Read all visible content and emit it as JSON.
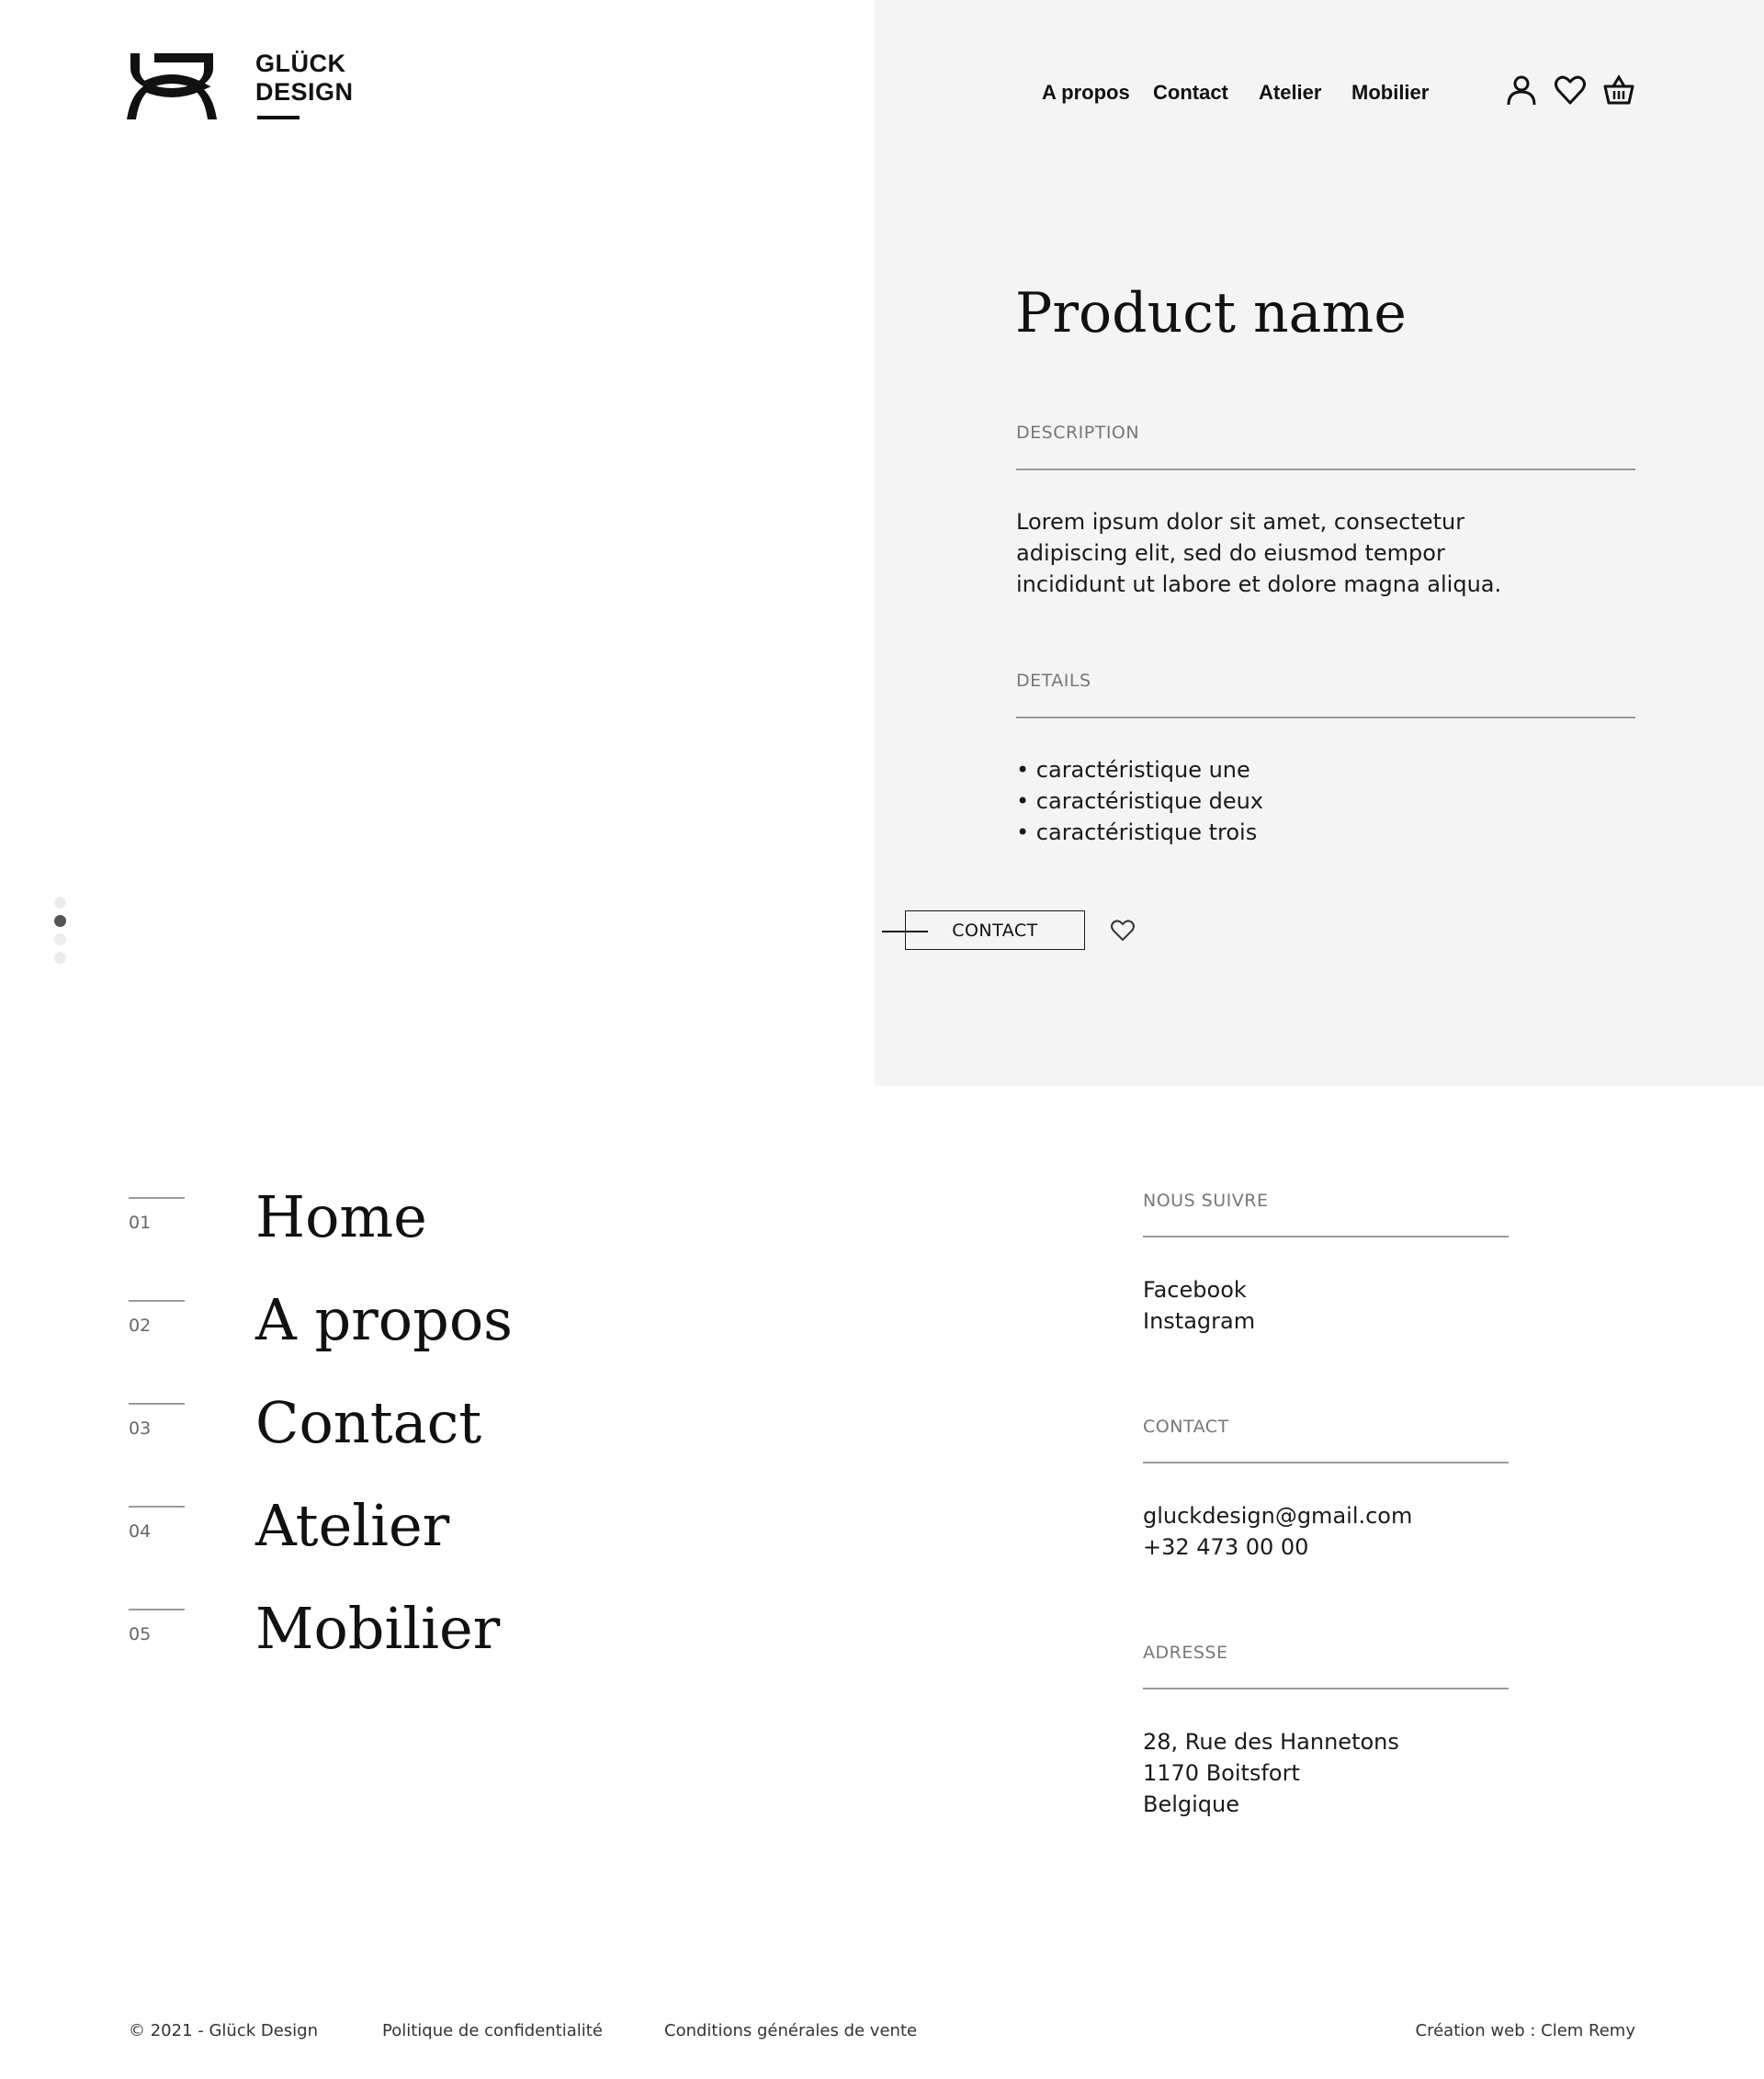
{
  "brand": {
    "line1": "GLÜCK",
    "line2": "DESIGN"
  },
  "nav": {
    "items": [
      "A propos",
      "Contact",
      "Atelier",
      "Mobilier"
    ]
  },
  "header_icons": [
    "user-icon",
    "heart-icon",
    "basket-icon"
  ],
  "product": {
    "name": "Product name",
    "description_label": "DESCRIPTION",
    "description_lines": [
      "Lorem ipsum dolor sit amet, consectetur",
      "adipiscing elit, sed do eiusmod tempor",
      "incididunt ut labore et dolore magna aliqua."
    ],
    "details_label": "DETAILS",
    "details": [
      "• caractéristique une",
      "• caractéristique deux",
      "• caractéristique trois"
    ],
    "contact_button": "CONTACT"
  },
  "carousel": {
    "dots": 4,
    "active_index": 1
  },
  "footer_menu": [
    {
      "num": "01",
      "label": "Home"
    },
    {
      "num": "02",
      "label": "A propos"
    },
    {
      "num": "03",
      "label": "Contact"
    },
    {
      "num": "04",
      "label": "Atelier"
    },
    {
      "num": "05",
      "label": "Mobilier"
    }
  ],
  "follow": {
    "label": "NOUS SUIVRE",
    "links": [
      "Facebook",
      "Instagram"
    ]
  },
  "contact": {
    "label": "CONTACT",
    "email": "gluckdesign@gmail.com",
    "phone": "+32 473 00 00"
  },
  "address": {
    "label": "ADRESSE",
    "lines": [
      "28, Rue des Hannetons",
      "1170 Boitsfort",
      "Belgique"
    ]
  },
  "legal": {
    "copyright": "© 2021 - Glück Design",
    "privacy": "Politique de confidentialité",
    "terms": "Conditions générales de vente",
    "credit": "Création web : Clem Remy"
  },
  "colors": {
    "panel_bg": "#f4f4f4",
    "text": "#111111",
    "muted": "#777777",
    "rule": "#9a9a9a"
  }
}
